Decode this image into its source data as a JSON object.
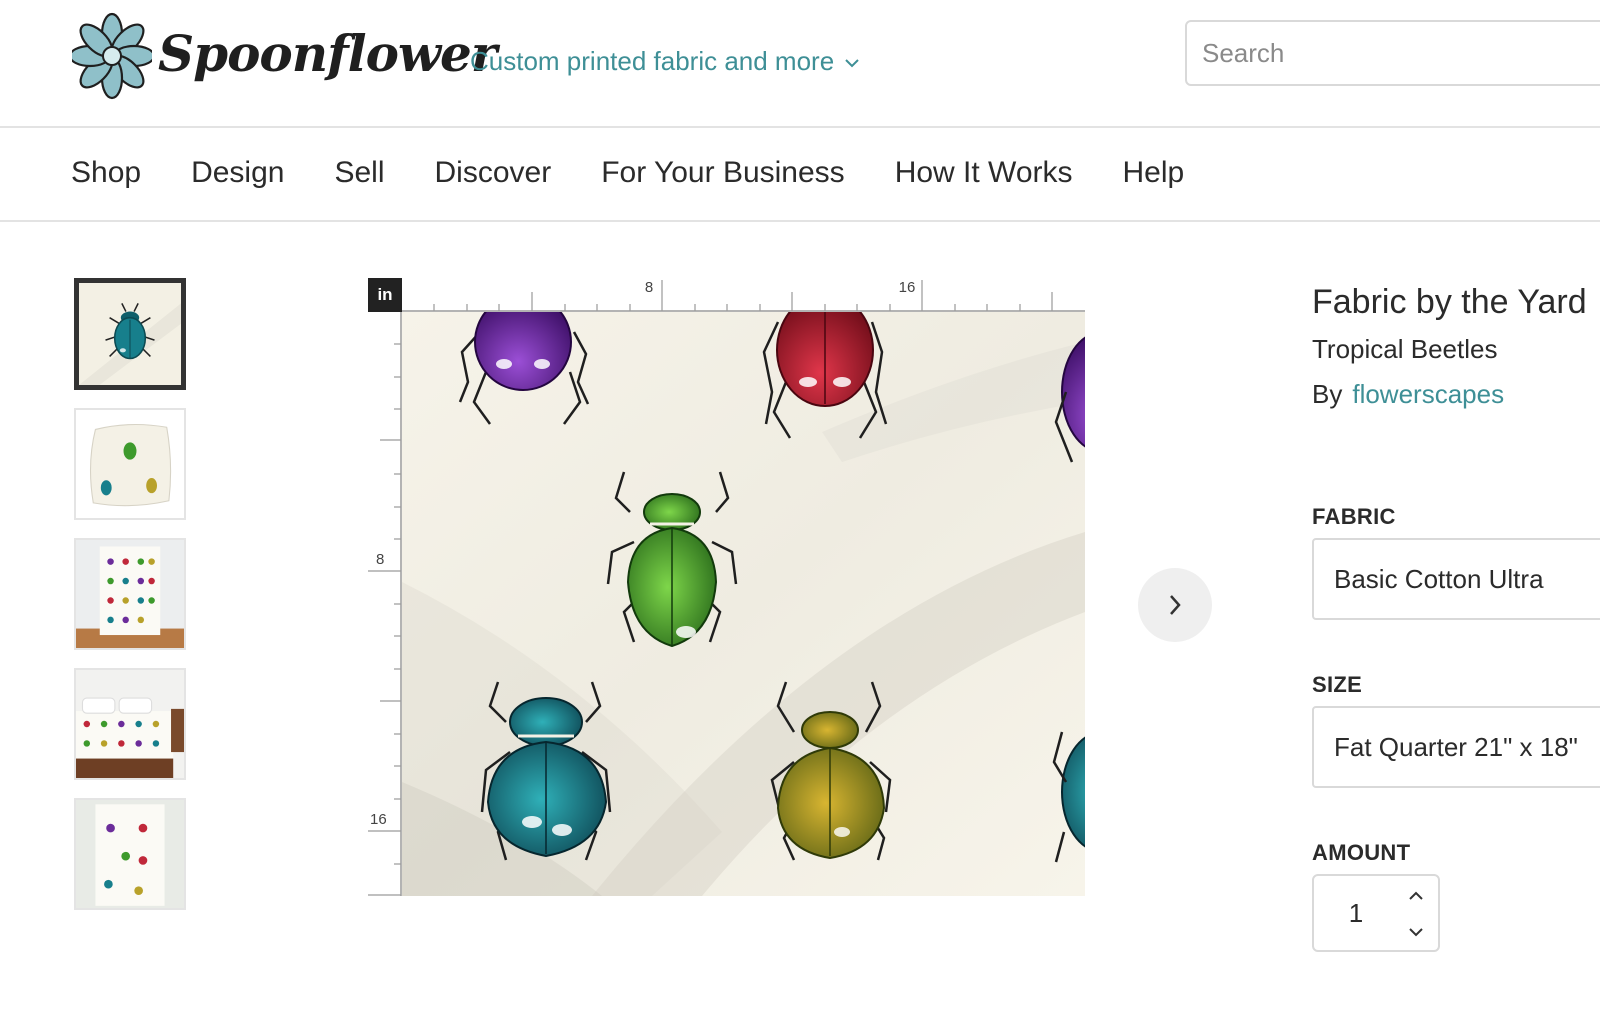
{
  "header": {
    "brand": "Spoonflower",
    "tagline": "Custom printed fabric and more",
    "search_placeholder": "Search",
    "colors": {
      "accent": "#3e8f96",
      "logo_flower": "#8fc0c9"
    }
  },
  "nav": {
    "items": [
      "Shop",
      "Design",
      "Sell",
      "Discover",
      "For Your Business",
      "How It Works",
      "Help"
    ]
  },
  "gallery": {
    "thumbnails": [
      {
        "name": "swatch",
        "active": true
      },
      {
        "name": "pillow",
        "active": false
      },
      {
        "name": "throw-blanket",
        "active": false
      },
      {
        "name": "duvet-bedroom",
        "active": false
      },
      {
        "name": "tea-towel",
        "active": false
      }
    ]
  },
  "preview": {
    "unit_label": "in",
    "ruler_top_labels": [
      "8",
      "16"
    ],
    "ruler_left_labels": [
      "8",
      "16"
    ],
    "next_icon": "chevron-right-icon"
  },
  "product": {
    "title": "Fabric by the Yard",
    "design_name": "Tropical Beetles",
    "by_label": "By",
    "designer": "flowerscapes",
    "fabric_label": "FABRIC",
    "fabric_value": "Basic Cotton Ultra",
    "size_label": "SIZE",
    "size_value": "Fat Quarter 21\" x 18\"",
    "amount_label": "AMOUNT",
    "amount_value": "1"
  }
}
